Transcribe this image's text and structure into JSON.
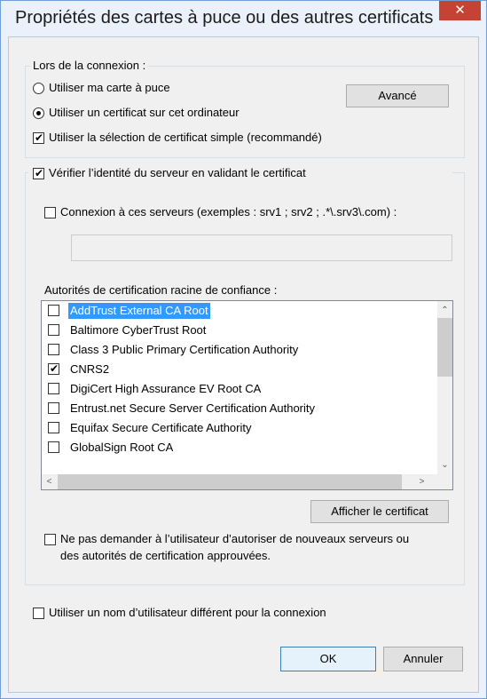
{
  "window": {
    "title": "Propriétés des cartes à puce ou des autres certificats",
    "close_glyph": "✕"
  },
  "connection_group": {
    "legend": "Lors de la connexion :",
    "radio_smartcard_label": "Utiliser ma carte à puce",
    "radio_certificate_label": "Utiliser un certificat sur cet ordinateur",
    "simple_selection_label": "Utiliser la sélection de certificat simple (recommandé)",
    "advanced_button": "Avancé"
  },
  "server_group": {
    "verify_label": "Vérifier l’identité du serveur en validant le certificat",
    "connect_servers_label": "Connexion à ces serveurs (exemples : srv1 ; srv2 ; .*\\.srv3\\.com) :",
    "servers_input_value": "",
    "root_ca_label": "Autorités de certification racine de confiance :",
    "root_ca_list": [
      {
        "label": "AddTrust External CA Root",
        "checked": false,
        "selected": true
      },
      {
        "label": "Baltimore CyberTrust Root",
        "checked": false,
        "selected": false
      },
      {
        "label": "Class 3 Public Primary Certification Authority",
        "checked": false,
        "selected": false
      },
      {
        "label": "CNRS2",
        "checked": true,
        "selected": false
      },
      {
        "label": "DigiCert High Assurance EV Root CA",
        "checked": false,
        "selected": false
      },
      {
        "label": "Entrust.net Secure Server Certification Authority",
        "checked": false,
        "selected": false
      },
      {
        "label": "Equifax Secure Certificate Authority",
        "checked": false,
        "selected": false
      },
      {
        "label": "GlobalSign Root CA",
        "checked": false,
        "selected": false
      }
    ],
    "show_certificate_button": "Afficher le certificat",
    "no_prompt_label_line1": "Ne pas demander à l’utilisateur d’autoriser de nouveaux serveurs ou",
    "no_prompt_label_line2": "des autorités de certification approuvées."
  },
  "different_user_label": "Utiliser un nom d’utilisateur différent pour la connexion",
  "buttons": {
    "ok": "OK",
    "cancel": "Annuler"
  },
  "colors": {
    "selection": "#3399ff",
    "close_button": "#c74234",
    "window_frame": "#eaf1fa"
  }
}
